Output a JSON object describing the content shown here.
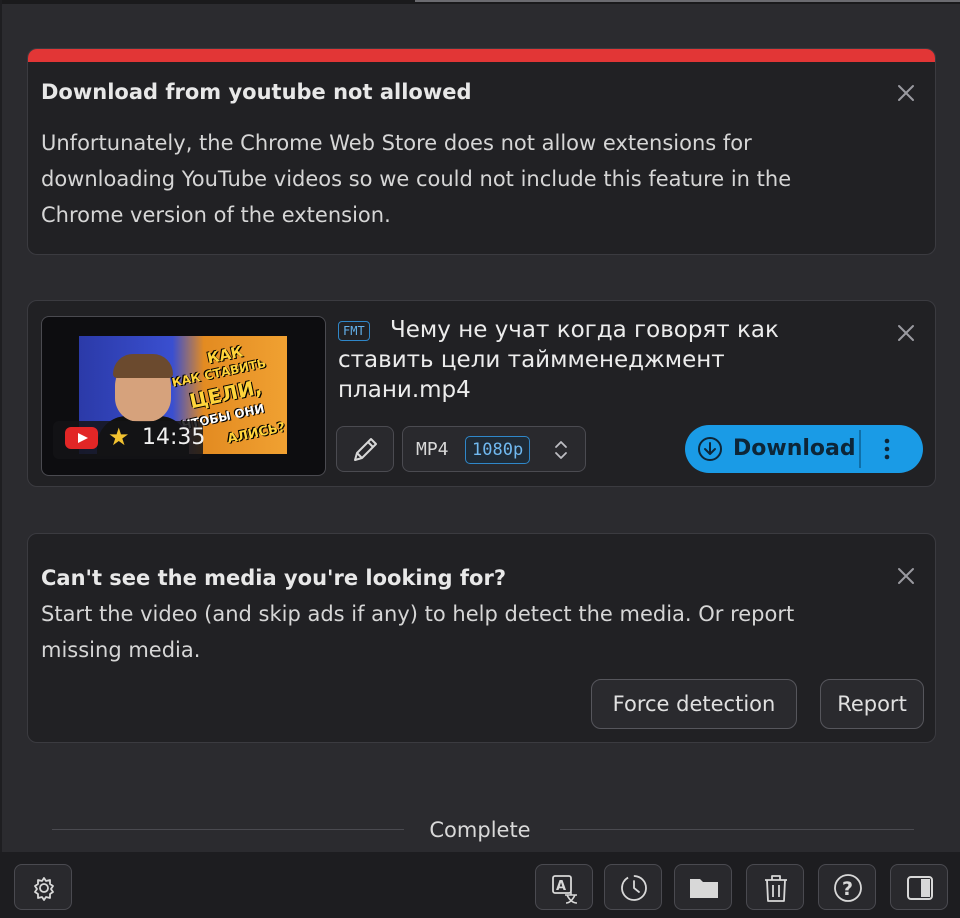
{
  "notice": {
    "title": "Download from youtube not allowed",
    "body": "Unfortunately, the Chrome Web Store does not allow extensions for downloading YouTube videos so we could not include this feature in the Chrome version of the extension."
  },
  "media": {
    "badge": "FMT",
    "filename": "Чему не учат когда говорят как ставить цели тайммeнеджмент плани.mp4",
    "duration": "14:35",
    "thumbnail_text": [
      "КАК",
      "КАК СТАВИТЬ",
      "ЦЕЛИ,",
      "ЧТОБЫ ОНИ",
      "АЛИСЬ?"
    ],
    "format": "MP4",
    "quality": "1080p",
    "download_label": "Download"
  },
  "hint": {
    "title": "Can't see the media you're looking for?",
    "body": "Start the video (and skip ads if any) to help detect the media. Or report missing media.",
    "force_label": "Force detection",
    "report_label": "Report"
  },
  "status": {
    "complete_label": "Complete"
  },
  "toolbar": {
    "icons": [
      "settings-icon",
      "translate-icon",
      "history-icon",
      "folder-icon",
      "trash-icon",
      "help-icon",
      "sidebar-icon"
    ]
  },
  "colors": {
    "accent": "#1a9be6",
    "alert": "#e23636",
    "background": "#2b2b2f",
    "card": "#212124"
  }
}
